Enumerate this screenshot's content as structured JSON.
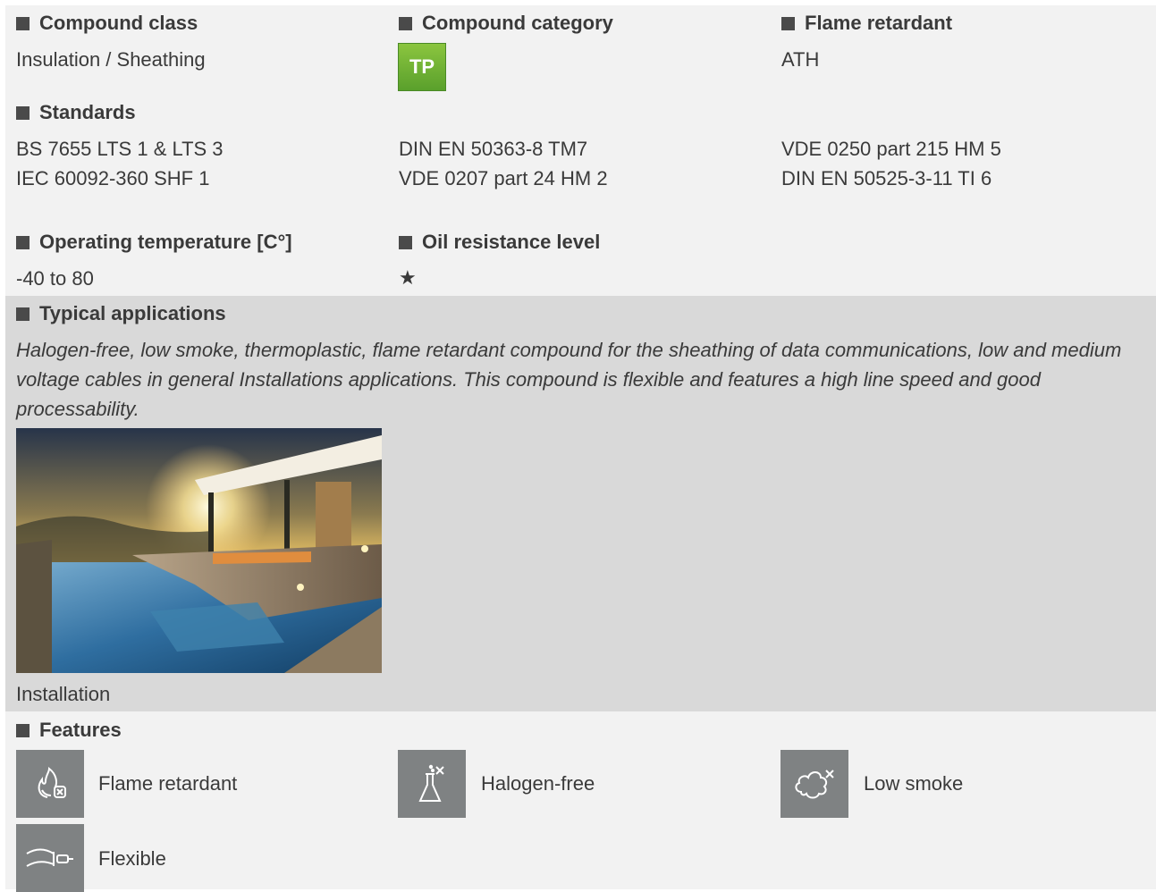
{
  "sections": {
    "compound_class": {
      "heading": "Compound class",
      "value": "Insulation / Sheathing"
    },
    "compound_category": {
      "heading": "Compound category",
      "badge": "TP",
      "badge_color": "#6cb233"
    },
    "flame_retardant": {
      "heading": "Flame retardant",
      "value": "ATH"
    },
    "standards": {
      "heading": "Standards",
      "items": [
        "BS 7655 LTS 1 & LTS 3",
        "IEC 60092-360 SHF 1",
        "DIN EN 50363-8 TM7",
        "VDE 0207 part 24 HM 2",
        "VDE 0250 part 215 HM 5",
        "DIN EN 50525-3-11 TI 6"
      ]
    },
    "operating_temperature": {
      "heading": "Operating temperature [C°]",
      "value": "-40 to 80"
    },
    "oil_resistance": {
      "heading": "Oil resistance level",
      "value": "★"
    },
    "typical_applications": {
      "heading": "Typical applications",
      "description": "Halogen-free, low smoke, thermoplastic, flame retardant compound for the sheathing of data communications, low and medium voltage cables in general Installations applications. This compound is flexible and features a high line speed and good processability.",
      "image_caption": "Installation"
    },
    "features": {
      "heading": "Features",
      "items": [
        {
          "icon": "flame-retardant-icon",
          "label": "Flame retardant"
        },
        {
          "icon": "halogen-free-icon",
          "label": "Halogen-free"
        },
        {
          "icon": "low-smoke-icon",
          "label": "Low smoke"
        },
        {
          "icon": "flexible-icon",
          "label": "Flexible"
        }
      ]
    }
  }
}
